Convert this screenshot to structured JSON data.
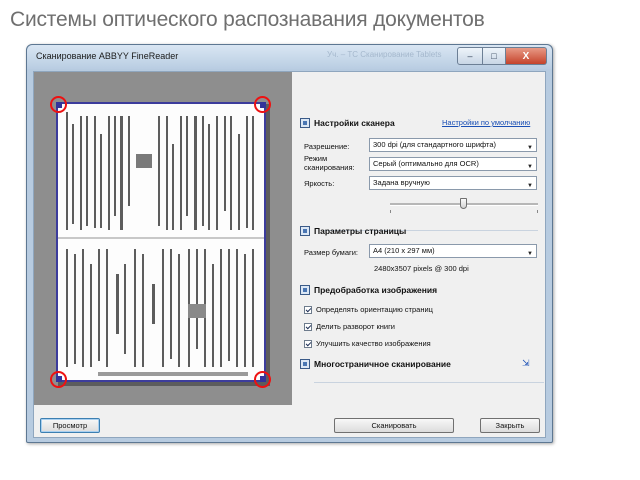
{
  "slide": {
    "title": "Системы оптического распознавания документов"
  },
  "window": {
    "title": "Сканирование ABBYY FineReader",
    "ghost_title": "Уч. – ТС Сканирование Tablets"
  },
  "caption_buttons": {
    "minimize": "–",
    "maximize": "□",
    "close": "X"
  },
  "scanner_settings": {
    "header": "Настройки сканера",
    "defaults_link": "Настройки по умолчанию",
    "resolution_label": "Разрешение:",
    "resolution_value": "300 dpi (для стандартного шрифта)",
    "mode_label": "Режим сканирования:",
    "mode_value": "Серый (оптимально для OCR)",
    "brightness_label": "Яркость:",
    "brightness_value": "Задана вручную",
    "brightness_level": 0.5
  },
  "page_params": {
    "header": "Параметры страницы",
    "paper_label": "Размер бумаги:",
    "paper_value": "A4 (210 x 297 мм)",
    "pixels_hint": "2480x3507 pixels @ 300 dpi"
  },
  "preprocessing": {
    "header": "Предобработка изображения",
    "options": [
      {
        "label": "Определять ориентацию страниц",
        "checked": true
      },
      {
        "label": "Делить разворот книги",
        "checked": true
      },
      {
        "label": "Улучшить качество изображения",
        "checked": true
      }
    ]
  },
  "multipage": {
    "header": "Многостраничное сканирование"
  },
  "buttons": {
    "preview": "Просмотр",
    "scan": "Сканировать",
    "close": "Закрыть"
  },
  "colors": {
    "highlight_circles": "#e11111",
    "link": "#1a4fb5",
    "selection_frame": "#3c3c9c"
  }
}
